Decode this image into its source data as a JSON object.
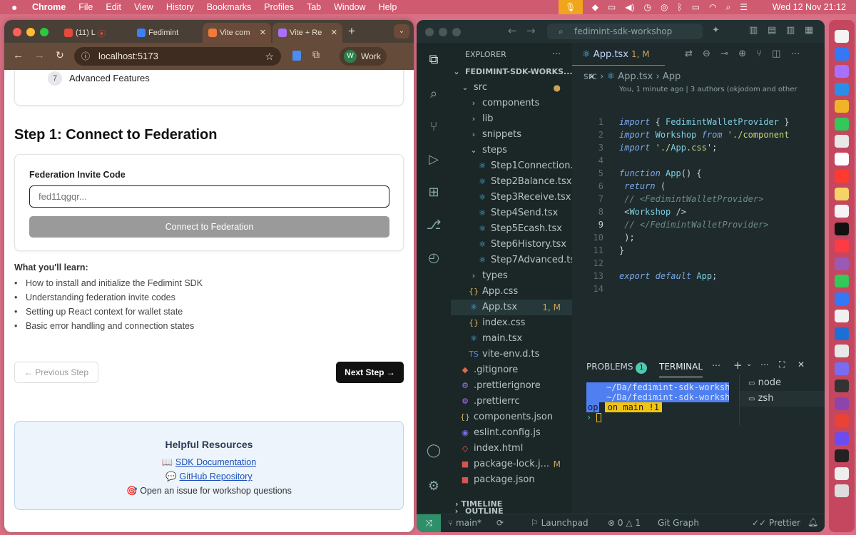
{
  "menubar": {
    "app_name": "Chrome",
    "items": [
      "File",
      "Edit",
      "View",
      "History",
      "Bookmarks",
      "Profiles",
      "Tab",
      "Window",
      "Help"
    ],
    "datetime": "Wed 12 Nov  21:12"
  },
  "chrome": {
    "tabs": [
      {
        "label": "(11) L",
        "fav_color": "#e64a3b"
      },
      {
        "label": "Fedimint",
        "fav_color": "#3b82f6"
      },
      {
        "label": "Vite com",
        "fav_color": "#ef7a3b"
      },
      {
        "label": "Vite + Re",
        "fav_color": "#a970ff"
      }
    ],
    "url": "localhost:5173",
    "profile": {
      "initial": "W",
      "label": "Work"
    }
  },
  "page": {
    "step7": {
      "number": "7",
      "label": "Advanced Features"
    },
    "step_title": "Step 1: Connect to Federation",
    "invite": {
      "label": "Federation Invite Code",
      "placeholder": "fed11qgqr...",
      "button": "Connect to Federation"
    },
    "learn": {
      "title": "What you'll learn:",
      "items": [
        "How to install and initialize the Fedimint SDK",
        "Understanding federation invite codes",
        "Setting up React context for wallet state",
        "Basic error handling and connection states"
      ]
    },
    "prev_button": "← Previous Step",
    "next_button": "Next Step →",
    "resources": {
      "title": "Helpful Resources",
      "sdk_doc": {
        "icon": "📖",
        "text": "SDK Documentation"
      },
      "github": {
        "icon": "💬",
        "text": "GitHub Repository"
      },
      "issue": {
        "icon": "🎯",
        "text": "Open an issue for workshop questions"
      }
    }
  },
  "vscode": {
    "search": "fedimint-sdk-workshop",
    "explorer_title": "EXPLORER",
    "project": "FEDIMINT-SDK-WORKS...",
    "tree": [
      {
        "label": "src",
        "icon": "chevron-down",
        "indent": 1,
        "mark": "●"
      },
      {
        "label": "components",
        "icon": "chevron-right",
        "indent": 2,
        "mark": ""
      },
      {
        "label": "lib",
        "icon": "chevron-right",
        "indent": 2,
        "mark": ""
      },
      {
        "label": "snippets",
        "icon": "chevron-right",
        "indent": 2,
        "mark": ""
      },
      {
        "label": "steps",
        "icon": "chevron-down",
        "indent": 2,
        "mark": ""
      },
      {
        "label": "Step1Connection....",
        "icon": "react",
        "indent": 3,
        "mark": ""
      },
      {
        "label": "Step2Balance.tsx",
        "icon": "react",
        "indent": 3,
        "mark": ""
      },
      {
        "label": "Step3Receive.tsx",
        "icon": "react",
        "indent": 3,
        "mark": ""
      },
      {
        "label": "Step4Send.tsx",
        "icon": "react",
        "indent": 3,
        "mark": ""
      },
      {
        "label": "Step5Ecash.tsx",
        "icon": "react",
        "indent": 3,
        "mark": ""
      },
      {
        "label": "Step6History.tsx",
        "icon": "react",
        "indent": 3,
        "mark": ""
      },
      {
        "label": "Step7Advanced.tsx",
        "icon": "react",
        "indent": 3,
        "mark": ""
      },
      {
        "label": "types",
        "icon": "chevron-right",
        "indent": 2,
        "mark": ""
      },
      {
        "label": "App.css",
        "icon": "css",
        "indent": 2,
        "mark": ""
      },
      {
        "label": "App.tsx",
        "icon": "react",
        "indent": 2,
        "mark": "1, M"
      },
      {
        "label": "index.css",
        "icon": "css",
        "indent": 2,
        "mark": ""
      },
      {
        "label": "main.tsx",
        "icon": "react",
        "indent": 2,
        "mark": ""
      },
      {
        "label": "vite-env.d.ts",
        "icon": "ts",
        "indent": 2,
        "mark": ""
      },
      {
        "label": ".gitignore",
        "icon": "git",
        "indent": 1,
        "mark": ""
      },
      {
        "label": ".prettierignore",
        "icon": "gear",
        "indent": 1,
        "mark": ""
      },
      {
        "label": ".prettierrc",
        "icon": "gear",
        "indent": 1,
        "mark": ""
      },
      {
        "label": "components.json",
        "icon": "json",
        "indent": 1,
        "mark": ""
      },
      {
        "label": "eslint.config.js",
        "icon": "eslint",
        "indent": 1,
        "mark": ""
      },
      {
        "label": "index.html",
        "icon": "html",
        "indent": 1,
        "mark": ""
      },
      {
        "label": "package-lock.j...",
        "icon": "npm",
        "indent": 1,
        "mark": "M"
      },
      {
        "label": "package.json",
        "icon": "npm",
        "indent": 1,
        "mark": ""
      }
    ],
    "outline": "OUTLINE",
    "timeline": "TIMELINE",
    "editor_tab": "App.tsx",
    "editor_tab_mark": "1, M",
    "breadcrumb": [
      "src",
      "App.tsx",
      "App"
    ],
    "blame": "You, 1 minute ago | 3 authors (okjodom and other",
    "code": [
      "import { FedimintWalletProvider }",
      "import Workshop from './component",
      "import './App.css';",
      "",
      "function App() {",
      "  return (",
      "    // <FedimintWalletProvider>",
      "      <Workshop />",
      "    // </FedimintWalletProvider>",
      "  );",
      "}",
      "",
      "export default App;",
      ""
    ],
    "panel": {
      "problems": "PROBLEMS",
      "problems_count": "1",
      "terminal": "TERMINAL",
      "term_lines": [
        "~/Da/fedimint-sdk-worksh",
        "~/Da/fedimint-sdk-worksh"
      ],
      "prompt_user": "op",
      "prompt_branch": "on main !1",
      "terminals": [
        "node",
        "zsh"
      ]
    },
    "status": {
      "branch": "main*",
      "launchpad": "Launchpad",
      "errors": "0",
      "warnings": "1",
      "git_graph": "Git Graph",
      "prettier": "Prettier"
    }
  }
}
